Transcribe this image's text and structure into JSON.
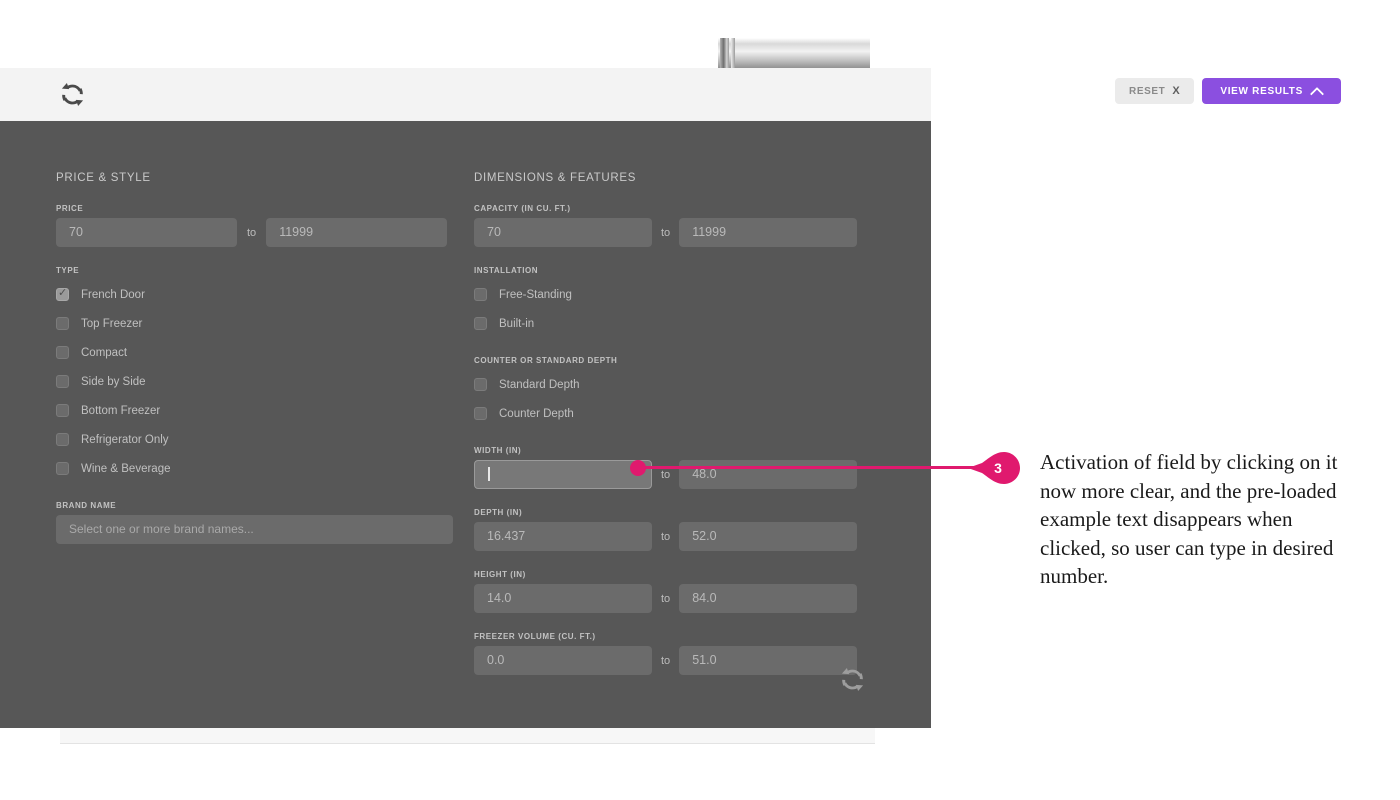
{
  "toolbar": {
    "sync_icon": "sync-refresh-icon",
    "reset_label": "RESET",
    "reset_close_glyph": "X",
    "view_results_label": "VIEW RESULTS",
    "view_results_chevron": "chevron-up-icon",
    "accent_purple": "#8b4fe0"
  },
  "panel": {
    "background": "#575757",
    "bottom_sync_icon": "sync-refresh-icon"
  },
  "left_column": {
    "section_title": "PRICE & STYLE",
    "price": {
      "label": "PRICE",
      "min_value": "70",
      "separator": "to",
      "max_value": "11999"
    },
    "type": {
      "label": "TYPE",
      "options": [
        {
          "label": "French Door",
          "checked": true
        },
        {
          "label": "Top Freezer",
          "checked": false
        },
        {
          "label": "Compact",
          "checked": false
        },
        {
          "label": "Side by Side",
          "checked": false
        },
        {
          "label": "Bottom Freezer",
          "checked": false
        },
        {
          "label": "Refrigerator Only",
          "checked": false
        },
        {
          "label": "Wine & Beverage",
          "checked": false
        }
      ]
    },
    "brand": {
      "label": "BRAND NAME",
      "placeholder": "Select one or more brand names..."
    }
  },
  "right_column": {
    "section_title": "DIMENSIONS & FEATURES",
    "capacity": {
      "label": "CAPACITY (IN CU. FT.)",
      "min_value": "70",
      "separator": "to",
      "max_value": "11999"
    },
    "installation": {
      "label": "INSTALLATION",
      "options": [
        {
          "label": "Free-Standing",
          "checked": false
        },
        {
          "label": "Built-in",
          "checked": false
        }
      ]
    },
    "depth_type": {
      "label": "COUNTER OR STANDARD DEPTH",
      "options": [
        {
          "label": "Standard Depth",
          "checked": false
        },
        {
          "label": "Counter Depth",
          "checked": false
        }
      ]
    },
    "width": {
      "label": "WIDTH (IN)",
      "min_value": "",
      "separator": "to",
      "max_value": "48.0",
      "active": true
    },
    "depth": {
      "label": "DEPTH (IN)",
      "min_value": "16.437",
      "separator": "to",
      "max_value": "52.0"
    },
    "height": {
      "label": "HEIGHT (IN)",
      "min_value": "14.0",
      "separator": "to",
      "max_value": "84.0"
    },
    "freezer_volume": {
      "label": "FREEZER VOLUME (CU. FT.)",
      "min_value": "0.0",
      "separator": "to",
      "max_value": "51.0"
    }
  },
  "annotation": {
    "number": "3",
    "color": "#e0196e",
    "text": "Activation of field by clicking on it now more clear, and the pre-loaded example text disappears when clicked, so user can type in desired number."
  }
}
